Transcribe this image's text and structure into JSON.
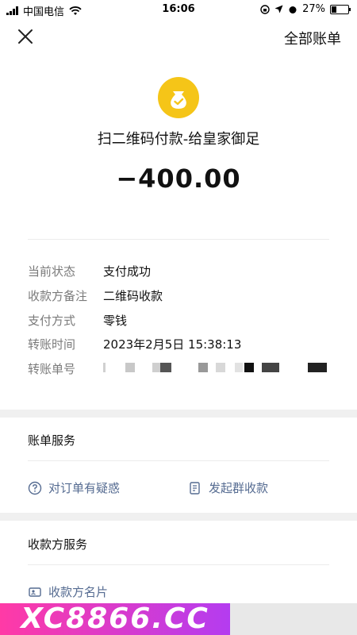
{
  "status_bar": {
    "carrier": "中国电信",
    "time": "16:06",
    "battery": "27%"
  },
  "header": {
    "all_bills_label": "全部账单"
  },
  "payment": {
    "title": "扫二维码付款-给皇家御足",
    "amount": "−400.00"
  },
  "details": [
    {
      "label": "当前状态",
      "value": "支付成功"
    },
    {
      "label": "收款方备注",
      "value": "二维码收款"
    },
    {
      "label": "支付方式",
      "value": "零钱"
    },
    {
      "label": "转账时间",
      "value": "2023年2月5日 15:38:13"
    },
    {
      "label": "转账单号",
      "value": ""
    }
  ],
  "bill_service": {
    "title": "账单服务",
    "query_order": "对订单有疑惑",
    "group_collect": "发起群收款"
  },
  "payee_service": {
    "title": "收款方服务",
    "card": "收款方名片"
  },
  "watermark": "XC8866.CC",
  "colors": {
    "coin": "#f5c518",
    "link": "#556b91",
    "watermark_start": "#ff3aa6",
    "watermark_end": "#b43cf0"
  }
}
